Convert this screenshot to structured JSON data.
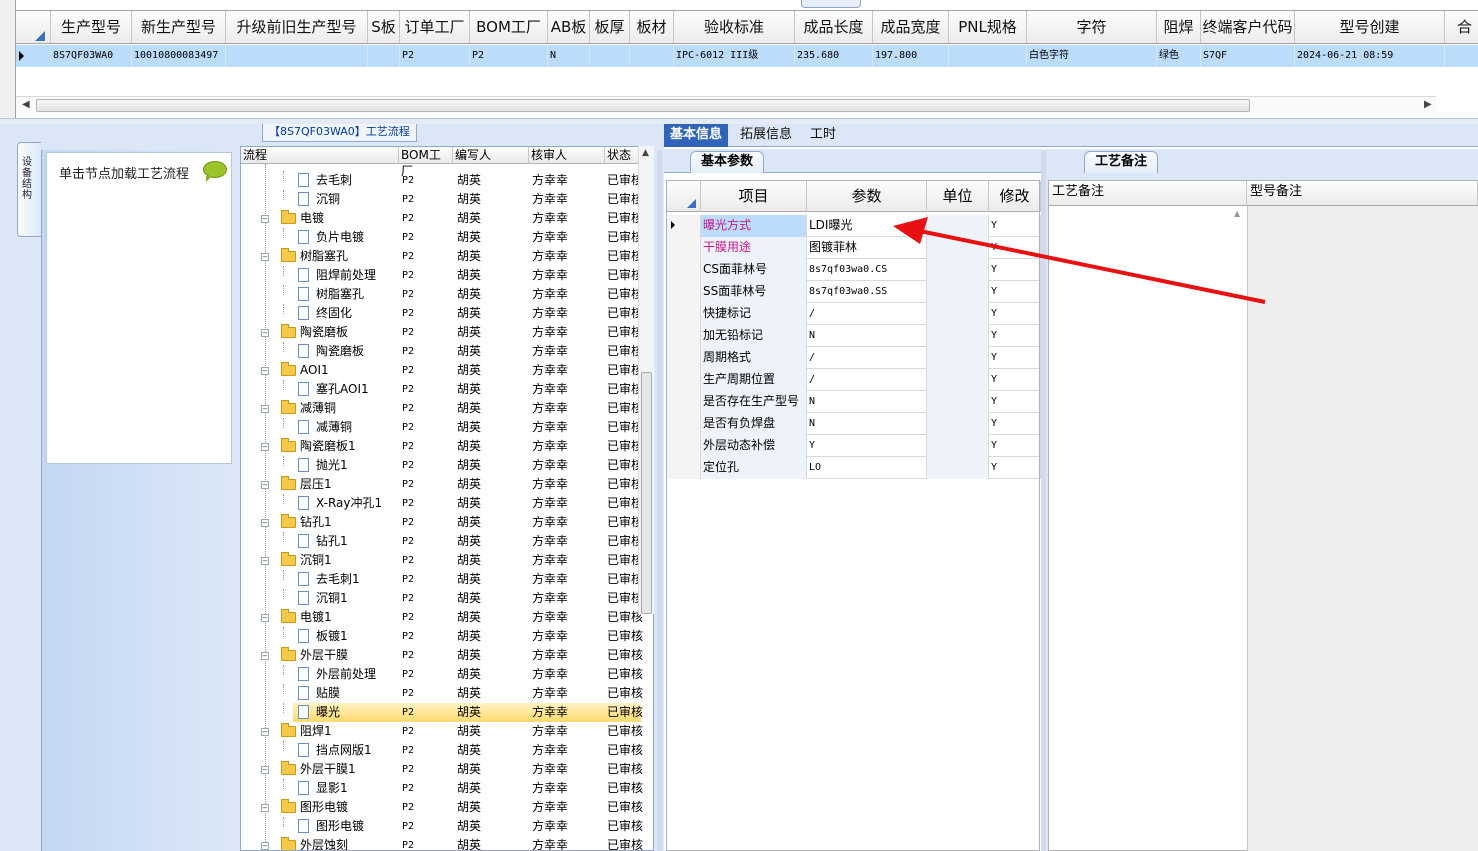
{
  "top_grid": {
    "tab_nub_label": "",
    "columns": [
      "生产型号",
      "新生产型号",
      "升级前旧生产型号",
      "S板",
      "订单工厂",
      "BOM工厂",
      "AB板",
      "板厚",
      "板材",
      "验收标准",
      "成品长度",
      "成品宽度",
      "PNL规格",
      "字符",
      "阻焊",
      "终端客户代码",
      "型号创建"
    ],
    "partial_column": "合",
    "row": [
      "8S7QF03WA0",
      "10010800083497",
      "",
      "",
      "P2",
      "P2",
      "N",
      "",
      "",
      "IPC-6012 III级",
      "235.680",
      "197.800",
      "",
      "白色字符",
      "绿色",
      "S7QF",
      "2024-06-21 08:59"
    ]
  },
  "left_tab_label": "设备结构",
  "left_panel_text": "单击节点加载工艺流程",
  "process_title": "【8S7QF03WA0】工艺流程",
  "process_tree": {
    "headers": [
      "流程",
      "BOM工厂",
      "编写人",
      "核审人",
      "状态"
    ],
    "rows": [
      {
        "name": "去毛刺",
        "kind": "doc",
        "factory": "P2",
        "writer": "胡英",
        "reviewer": "方幸幸",
        "status": "已审核"
      },
      {
        "name": "沉铜",
        "kind": "doc",
        "factory": "P2",
        "writer": "胡英",
        "reviewer": "方幸幸",
        "status": "已审核"
      },
      {
        "name": "电镀",
        "kind": "folder",
        "factory": "P2",
        "writer": "胡英",
        "reviewer": "方幸幸",
        "status": "已审核"
      },
      {
        "name": "负片电镀",
        "kind": "doc",
        "factory": "P2",
        "writer": "胡英",
        "reviewer": "方幸幸",
        "status": "已审核"
      },
      {
        "name": "树脂塞孔",
        "kind": "folder",
        "factory": "P2",
        "writer": "胡英",
        "reviewer": "方幸幸",
        "status": "已审核"
      },
      {
        "name": "阻焊前处理",
        "kind": "doc",
        "factory": "P2",
        "writer": "胡英",
        "reviewer": "方幸幸",
        "status": "已审核"
      },
      {
        "name": "树脂塞孔",
        "kind": "doc",
        "factory": "P2",
        "writer": "胡英",
        "reviewer": "方幸幸",
        "status": "已审核"
      },
      {
        "name": "终固化",
        "kind": "doc",
        "factory": "P2",
        "writer": "胡英",
        "reviewer": "方幸幸",
        "status": "已审核"
      },
      {
        "name": "陶瓷磨板",
        "kind": "folder",
        "factory": "P2",
        "writer": "胡英",
        "reviewer": "方幸幸",
        "status": "已审核"
      },
      {
        "name": "陶瓷磨板",
        "kind": "doc",
        "factory": "P2",
        "writer": "胡英",
        "reviewer": "方幸幸",
        "status": "已审核"
      },
      {
        "name": "AOI1",
        "kind": "folder",
        "factory": "P2",
        "writer": "胡英",
        "reviewer": "方幸幸",
        "status": "已审核"
      },
      {
        "name": "塞孔AOI1",
        "kind": "doc",
        "factory": "P2",
        "writer": "胡英",
        "reviewer": "方幸幸",
        "status": "已审核"
      },
      {
        "name": "减薄铜",
        "kind": "folder",
        "factory": "P2",
        "writer": "胡英",
        "reviewer": "方幸幸",
        "status": "已审核"
      },
      {
        "name": "减薄铜",
        "kind": "doc",
        "factory": "P2",
        "writer": "胡英",
        "reviewer": "方幸幸",
        "status": "已审核"
      },
      {
        "name": "陶瓷磨板1",
        "kind": "folder",
        "factory": "P2",
        "writer": "胡英",
        "reviewer": "方幸幸",
        "status": "已审核"
      },
      {
        "name": "抛光1",
        "kind": "doc",
        "factory": "P2",
        "writer": "胡英",
        "reviewer": "方幸幸",
        "status": "已审核"
      },
      {
        "name": "层压1",
        "kind": "folder",
        "factory": "P2",
        "writer": "胡英",
        "reviewer": "方幸幸",
        "status": "已审核"
      },
      {
        "name": "X-Ray冲孔1",
        "kind": "doc",
        "factory": "P2",
        "writer": "胡英",
        "reviewer": "方幸幸",
        "status": "已审核"
      },
      {
        "name": "钻孔1",
        "kind": "folder",
        "factory": "P2",
        "writer": "胡英",
        "reviewer": "方幸幸",
        "status": "已审核"
      },
      {
        "name": "钻孔1",
        "kind": "doc",
        "factory": "P2",
        "writer": "胡英",
        "reviewer": "方幸幸",
        "status": "已审核"
      },
      {
        "name": "沉铜1",
        "kind": "folder",
        "factory": "P2",
        "writer": "胡英",
        "reviewer": "方幸幸",
        "status": "已审核"
      },
      {
        "name": "去毛刺1",
        "kind": "doc",
        "factory": "P2",
        "writer": "胡英",
        "reviewer": "方幸幸",
        "status": "已审核"
      },
      {
        "name": "沉铜1",
        "kind": "doc",
        "factory": "P2",
        "writer": "胡英",
        "reviewer": "方幸幸",
        "status": "已审核"
      },
      {
        "name": "电镀1",
        "kind": "folder",
        "factory": "P2",
        "writer": "胡英",
        "reviewer": "方幸幸",
        "status": "已审核"
      },
      {
        "name": "板镀1",
        "kind": "doc",
        "factory": "P2",
        "writer": "胡英",
        "reviewer": "方幸幸",
        "status": "已审核"
      },
      {
        "name": "外层干膜",
        "kind": "folder",
        "factory": "P2",
        "writer": "胡英",
        "reviewer": "方幸幸",
        "status": "已审核"
      },
      {
        "name": "外层前处理",
        "kind": "doc",
        "factory": "P2",
        "writer": "胡英",
        "reviewer": "方幸幸",
        "status": "已审核"
      },
      {
        "name": "贴膜",
        "kind": "doc",
        "factory": "P2",
        "writer": "胡英",
        "reviewer": "方幸幸",
        "status": "已审核"
      },
      {
        "name": "曝光",
        "kind": "doc",
        "factory": "P2",
        "writer": "胡英",
        "reviewer": "方幸幸",
        "status": "已审核",
        "selected": true
      },
      {
        "name": "阻焊1",
        "kind": "folder",
        "factory": "P2",
        "writer": "胡英",
        "reviewer": "方幸幸",
        "status": "已审核"
      },
      {
        "name": "挡点网版1",
        "kind": "doc",
        "factory": "P2",
        "writer": "胡英",
        "reviewer": "方幸幸",
        "status": "已审核"
      },
      {
        "name": "外层干膜1",
        "kind": "folder",
        "factory": "P2",
        "writer": "胡英",
        "reviewer": "方幸幸",
        "status": "已审核"
      },
      {
        "name": "显影1",
        "kind": "doc",
        "factory": "P2",
        "writer": "胡英",
        "reviewer": "方幸幸",
        "status": "已审核"
      },
      {
        "name": "图形电镀",
        "kind": "folder",
        "factory": "P2",
        "writer": "胡英",
        "reviewer": "方幸幸",
        "status": "已审核"
      },
      {
        "name": "图形电镀",
        "kind": "doc",
        "factory": "P2",
        "writer": "胡英",
        "reviewer": "方幸幸",
        "status": "已审核"
      },
      {
        "name": "外层蚀刻",
        "kind": "folder",
        "factory": "P2",
        "writer": "胡英",
        "reviewer": "方幸幸",
        "status": "已审核"
      }
    ]
  },
  "main_tabs": [
    "基本信息",
    "拓展信息",
    "工时"
  ],
  "params_tab": "基本参数",
  "params": {
    "headers": [
      "项目",
      "参数",
      "单位",
      "修改"
    ],
    "rows": [
      {
        "item": "曝光方式",
        "value": "LDI曝光",
        "unit": "",
        "edit": "Y",
        "highlight": true
      },
      {
        "item": "干膜用途",
        "value": "图镀菲林",
        "unit": "",
        "edit": "Y",
        "highlight": true
      },
      {
        "item": "CS面菲林号",
        "value": "8s7qf03wa0.CS",
        "unit": "",
        "edit": "Y"
      },
      {
        "item": "SS面菲林号",
        "value": "8s7qf03wa0.SS",
        "unit": "",
        "edit": "Y"
      },
      {
        "item": "快捷标记",
        "value": "/",
        "unit": "",
        "edit": "Y"
      },
      {
        "item": "加无铅标记",
        "value": "N",
        "unit": "",
        "edit": "Y"
      },
      {
        "item": "周期格式",
        "value": "/",
        "unit": "",
        "edit": "Y"
      },
      {
        "item": "生产周期位置",
        "value": "/",
        "unit": "",
        "edit": "Y"
      },
      {
        "item": "是否存在生产型号",
        "value": "N",
        "unit": "",
        "edit": "Y"
      },
      {
        "item": "是否有负焊盘",
        "value": "N",
        "unit": "",
        "edit": "Y"
      },
      {
        "item": "外层动态补偿",
        "value": "Y",
        "unit": "",
        "edit": "Y"
      },
      {
        "item": "定位孔",
        "value": "LO",
        "unit": "",
        "edit": "Y"
      }
    ]
  },
  "remarks_tab": "工艺备注",
  "remarks_headers": [
    "工艺备注",
    "型号备注"
  ],
  "colors": {
    "selected_row": "#bcdcfb",
    "active_tab": "#2f64b8",
    "highlight_text": "#c8168e",
    "arrow": "#e81010"
  }
}
